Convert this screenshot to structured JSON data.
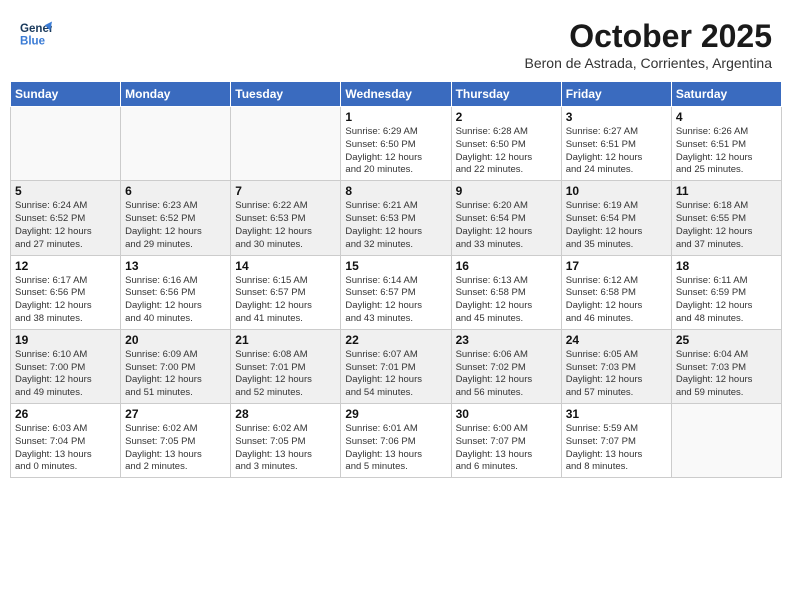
{
  "logo": {
    "line1": "General",
    "line2": "Blue"
  },
  "header": {
    "title": "October 2025",
    "subtitle": "Beron de Astrada, Corrientes, Argentina"
  },
  "weekdays": [
    "Sunday",
    "Monday",
    "Tuesday",
    "Wednesday",
    "Thursday",
    "Friday",
    "Saturday"
  ],
  "weeks": [
    [
      {
        "day": "",
        "info": ""
      },
      {
        "day": "",
        "info": ""
      },
      {
        "day": "",
        "info": ""
      },
      {
        "day": "1",
        "info": "Sunrise: 6:29 AM\nSunset: 6:50 PM\nDaylight: 12 hours\nand 20 minutes."
      },
      {
        "day": "2",
        "info": "Sunrise: 6:28 AM\nSunset: 6:50 PM\nDaylight: 12 hours\nand 22 minutes."
      },
      {
        "day": "3",
        "info": "Sunrise: 6:27 AM\nSunset: 6:51 PM\nDaylight: 12 hours\nand 24 minutes."
      },
      {
        "day": "4",
        "info": "Sunrise: 6:26 AM\nSunset: 6:51 PM\nDaylight: 12 hours\nand 25 minutes."
      }
    ],
    [
      {
        "day": "5",
        "info": "Sunrise: 6:24 AM\nSunset: 6:52 PM\nDaylight: 12 hours\nand 27 minutes."
      },
      {
        "day": "6",
        "info": "Sunrise: 6:23 AM\nSunset: 6:52 PM\nDaylight: 12 hours\nand 29 minutes."
      },
      {
        "day": "7",
        "info": "Sunrise: 6:22 AM\nSunset: 6:53 PM\nDaylight: 12 hours\nand 30 minutes."
      },
      {
        "day": "8",
        "info": "Sunrise: 6:21 AM\nSunset: 6:53 PM\nDaylight: 12 hours\nand 32 minutes."
      },
      {
        "day": "9",
        "info": "Sunrise: 6:20 AM\nSunset: 6:54 PM\nDaylight: 12 hours\nand 33 minutes."
      },
      {
        "day": "10",
        "info": "Sunrise: 6:19 AM\nSunset: 6:54 PM\nDaylight: 12 hours\nand 35 minutes."
      },
      {
        "day": "11",
        "info": "Sunrise: 6:18 AM\nSunset: 6:55 PM\nDaylight: 12 hours\nand 37 minutes."
      }
    ],
    [
      {
        "day": "12",
        "info": "Sunrise: 6:17 AM\nSunset: 6:56 PM\nDaylight: 12 hours\nand 38 minutes."
      },
      {
        "day": "13",
        "info": "Sunrise: 6:16 AM\nSunset: 6:56 PM\nDaylight: 12 hours\nand 40 minutes."
      },
      {
        "day": "14",
        "info": "Sunrise: 6:15 AM\nSunset: 6:57 PM\nDaylight: 12 hours\nand 41 minutes."
      },
      {
        "day": "15",
        "info": "Sunrise: 6:14 AM\nSunset: 6:57 PM\nDaylight: 12 hours\nand 43 minutes."
      },
      {
        "day": "16",
        "info": "Sunrise: 6:13 AM\nSunset: 6:58 PM\nDaylight: 12 hours\nand 45 minutes."
      },
      {
        "day": "17",
        "info": "Sunrise: 6:12 AM\nSunset: 6:58 PM\nDaylight: 12 hours\nand 46 minutes."
      },
      {
        "day": "18",
        "info": "Sunrise: 6:11 AM\nSunset: 6:59 PM\nDaylight: 12 hours\nand 48 minutes."
      }
    ],
    [
      {
        "day": "19",
        "info": "Sunrise: 6:10 AM\nSunset: 7:00 PM\nDaylight: 12 hours\nand 49 minutes."
      },
      {
        "day": "20",
        "info": "Sunrise: 6:09 AM\nSunset: 7:00 PM\nDaylight: 12 hours\nand 51 minutes."
      },
      {
        "day": "21",
        "info": "Sunrise: 6:08 AM\nSunset: 7:01 PM\nDaylight: 12 hours\nand 52 minutes."
      },
      {
        "day": "22",
        "info": "Sunrise: 6:07 AM\nSunset: 7:01 PM\nDaylight: 12 hours\nand 54 minutes."
      },
      {
        "day": "23",
        "info": "Sunrise: 6:06 AM\nSunset: 7:02 PM\nDaylight: 12 hours\nand 56 minutes."
      },
      {
        "day": "24",
        "info": "Sunrise: 6:05 AM\nSunset: 7:03 PM\nDaylight: 12 hours\nand 57 minutes."
      },
      {
        "day": "25",
        "info": "Sunrise: 6:04 AM\nSunset: 7:03 PM\nDaylight: 12 hours\nand 59 minutes."
      }
    ],
    [
      {
        "day": "26",
        "info": "Sunrise: 6:03 AM\nSunset: 7:04 PM\nDaylight: 13 hours\nand 0 minutes."
      },
      {
        "day": "27",
        "info": "Sunrise: 6:02 AM\nSunset: 7:05 PM\nDaylight: 13 hours\nand 2 minutes."
      },
      {
        "day": "28",
        "info": "Sunrise: 6:02 AM\nSunset: 7:05 PM\nDaylight: 13 hours\nand 3 minutes."
      },
      {
        "day": "29",
        "info": "Sunrise: 6:01 AM\nSunset: 7:06 PM\nDaylight: 13 hours\nand 5 minutes."
      },
      {
        "day": "30",
        "info": "Sunrise: 6:00 AM\nSunset: 7:07 PM\nDaylight: 13 hours\nand 6 minutes."
      },
      {
        "day": "31",
        "info": "Sunrise: 5:59 AM\nSunset: 7:07 PM\nDaylight: 13 hours\nand 8 minutes."
      },
      {
        "day": "",
        "info": ""
      }
    ]
  ]
}
